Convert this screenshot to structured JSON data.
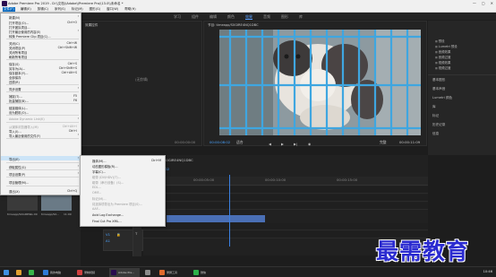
{
  "window": {
    "title": "Adobe Premiere Pro 2019 - D:\\\\文档\\\\Adobe\\\\Premiere Pro\\\\13.0\\\\未命名 *",
    "controls": [
      "—",
      "▢",
      "✕"
    ]
  },
  "menubar": {
    "items": [
      "文件(F)",
      "编辑(E)",
      "剪辑(C)",
      "序列(S)",
      "标记(M)",
      "图形(G)",
      "窗口(W)",
      "帮助(H)"
    ],
    "active_index": 0
  },
  "workspace_tabs": [
    "学习",
    "组件",
    "编辑",
    "颜色",
    "效果",
    "音频",
    "图形",
    "库"
  ],
  "workspace_active": 4,
  "source_monitor": {
    "title": "效果控件",
    "note": "(无剪辑)",
    "timecode": "00:00:00:00"
  },
  "program_monitor": {
    "title": "节目: timeapp/S0GIRE4NQ1DBC",
    "timecode_left": "00:00:08:02",
    "fit": "适合",
    "quality": "完整",
    "timecode_right": "00:00:11:09"
  },
  "effects_panel": {
    "tree_items": [
      "预设",
      "Lumetri 预设",
      "音频效果",
      "音频过渡",
      "视频效果",
      "视频过渡"
    ],
    "sections": [
      "基本图形",
      "基本声音",
      "Lumetri 颜色",
      "库",
      "标记",
      "历史记录",
      "信息"
    ]
  },
  "file_menu": {
    "items": [
      {
        "label": "新建(N)",
        "shortcut": "",
        "submenu": true,
        "disabled": false
      },
      {
        "label": "打开项目(O)...",
        "shortcut": "Ctrl+O",
        "submenu": false,
        "disabled": false
      },
      {
        "label": "打开团队项目...",
        "shortcut": "",
        "submenu": false,
        "disabled": false
      },
      {
        "label": "打开最近使用的内容(E)",
        "shortcut": "",
        "submenu": true,
        "disabled": false
      },
      {
        "label": "转换 Premiere Clip 项目(C)...",
        "shortcut": "",
        "submenu": false,
        "disabled": false
      },
      {
        "label": "关闭(C)",
        "shortcut": "Ctrl+W",
        "submenu": false,
        "disabled": false
      },
      {
        "label": "关闭项目(P)",
        "shortcut": "Ctrl+Shift+W",
        "submenu": false,
        "disabled": false
      },
      {
        "label": "关闭所有项目",
        "shortcut": "",
        "submenu": false,
        "disabled": false
      },
      {
        "label": "刷新所有项目",
        "shortcut": "",
        "submenu": false,
        "disabled": false
      },
      {
        "label": "保存(S)",
        "shortcut": "Ctrl+S",
        "submenu": false,
        "disabled": false
      },
      {
        "label": "另存为(A)...",
        "shortcut": "Ctrl+Shift+S",
        "submenu": false,
        "disabled": false
      },
      {
        "label": "保存副本(Y)...",
        "shortcut": "Ctrl+Alt+S",
        "submenu": false,
        "disabled": false
      },
      {
        "label": "全部保存",
        "shortcut": "",
        "submenu": false,
        "disabled": false
      },
      {
        "label": "还原(R)",
        "shortcut": "",
        "submenu": false,
        "disabled": false
      },
      {
        "label": "同步设置",
        "shortcut": "",
        "submenu": true,
        "disabled": false
      },
      {
        "label": "捕捉(T)...",
        "shortcut": "F5",
        "submenu": false,
        "disabled": false
      },
      {
        "label": "批量捕捉(B)...",
        "shortcut": "F6",
        "submenu": false,
        "disabled": false
      },
      {
        "label": "链接媒体(L)...",
        "shortcut": "",
        "submenu": false,
        "disabled": false
      },
      {
        "label": "设为脱机(O)...",
        "shortcut": "",
        "submenu": false,
        "disabled": false
      },
      {
        "label": "Adobe Dynamic Link(K)",
        "shortcut": "",
        "submenu": true,
        "disabled": true
      },
      {
        "label": "从媒体浏览器导入(M)",
        "shortcut": "Ctrl+Alt+I",
        "submenu": false,
        "disabled": true
      },
      {
        "label": "导入(I)...",
        "shortcut": "Ctrl+I",
        "submenu": false,
        "disabled": false
      },
      {
        "label": "导入最近使用的文件(F)",
        "shortcut": "",
        "submenu": true,
        "disabled": false
      },
      {
        "label": "导出(E)",
        "shortcut": "",
        "submenu": true,
        "disabled": false
      },
      {
        "label": "获取属性(G)",
        "shortcut": "",
        "submenu": true,
        "disabled": false
      },
      {
        "label": "项目设置(P)",
        "shortcut": "",
        "submenu": true,
        "disabled": false
      },
      {
        "label": "项目管理(M)...",
        "shortcut": "",
        "submenu": false,
        "disabled": false
      },
      {
        "label": "退出(X)",
        "shortcut": "Ctrl+Q",
        "submenu": false,
        "disabled": false
      }
    ]
  },
  "export_submenu": {
    "items": [
      {
        "label": "媒体(M)...",
        "shortcut": "Ctrl+M",
        "disabled": false
      },
      {
        "label": "动态图形模板(R)...",
        "shortcut": "",
        "disabled": false
      },
      {
        "label": "字幕(C)...",
        "shortcut": "",
        "disabled": false
      },
      {
        "label": "磁带 (DV/HDV)(T)...",
        "shortcut": "",
        "disabled": true
      },
      {
        "label": "磁带（串行设备）(S)...",
        "shortcut": "",
        "disabled": true
      },
      {
        "label": "EDL...",
        "shortcut": "",
        "disabled": true
      },
      {
        "label": "OMF...",
        "shortcut": "",
        "disabled": true
      },
      {
        "label": "标记(M)...",
        "shortcut": "",
        "disabled": true
      },
      {
        "label": "将选择项导出为 Premiere 项目(S)...",
        "shortcut": "",
        "disabled": true
      },
      {
        "label": "AAF...",
        "shortcut": "",
        "disabled": true
      },
      {
        "label": "Avid Log Exchange...",
        "shortcut": "",
        "disabled": false
      },
      {
        "label": "Final Cut Pro XML...",
        "shortcut": "",
        "disabled": false
      }
    ]
  },
  "timeline": {
    "title": "timeapp/S0GIRE4NQ1DBC",
    "timecode": "00:00:08:02",
    "ruler": [
      "00:00:00",
      "00:00:05:00",
      "00:00:10:00",
      "00:00:15:00"
    ]
  },
  "project_panel": {
    "thumbs": [
      "timeapp/S0GIRE4...",
      "timeapp/S0..."
    ],
    "durations": [
      "11:09",
      "11:09"
    ]
  },
  "taskbar": {
    "items": [
      "",
      "",
      "",
      "我的电脑",
      "录制视频",
      "Adobe Pre...",
      "",
      "录屏工具",
      "微信"
    ],
    "clock": "10:46"
  },
  "watermark": {
    "text": "最需教育"
  },
  "colors": {
    "accent": "#0067c0",
    "playhead": "#3b80e0",
    "timecode": "#4aa3ff",
    "clip": "#4a6fb5",
    "watermark": "#2b2bd0"
  }
}
